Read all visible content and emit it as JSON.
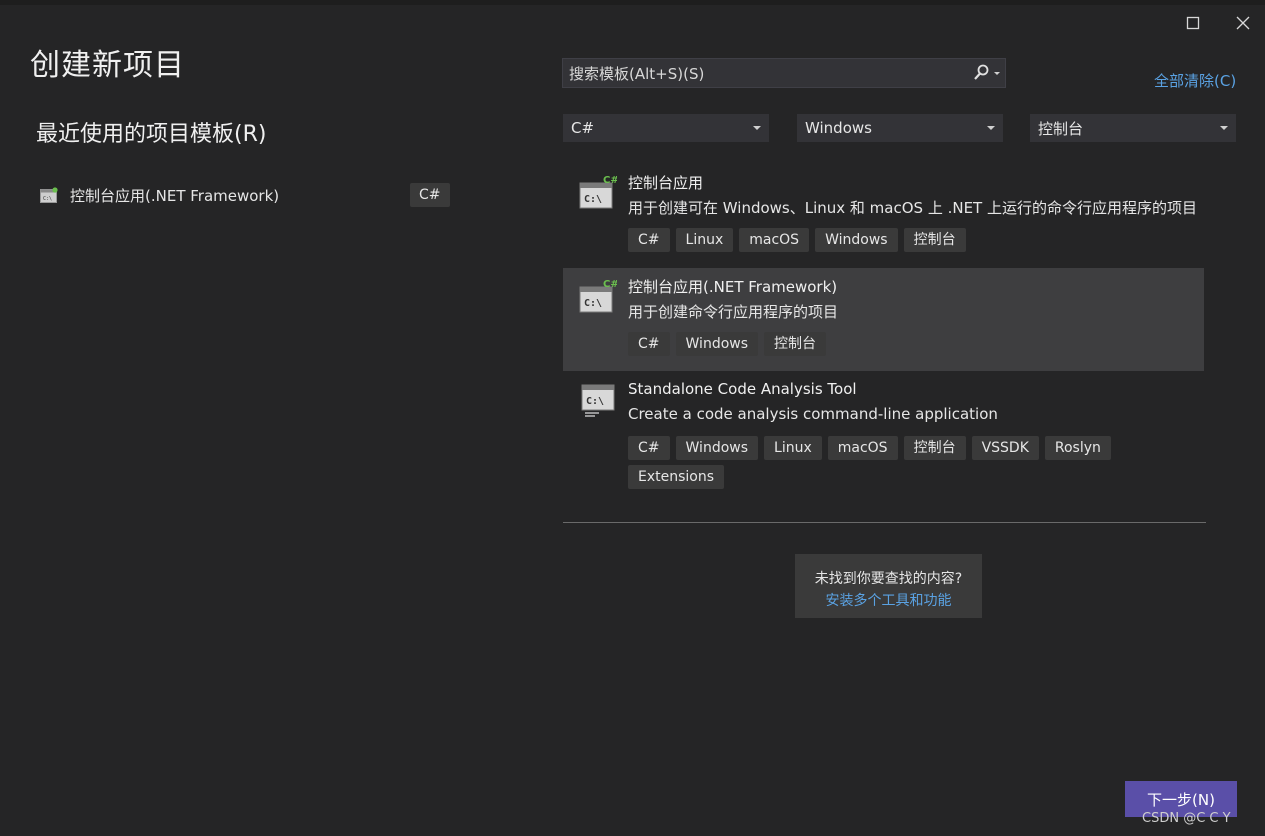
{
  "page": {
    "title": "创建新项目"
  },
  "recent": {
    "heading": "最近使用的项目模板(R)",
    "items": [
      {
        "label": "控制台应用(.NET Framework)",
        "language": "C#",
        "icon": "console-csharp-icon"
      }
    ]
  },
  "search": {
    "placeholder": "搜索模板(Alt+S)(S)",
    "icon": "search-icon"
  },
  "clear_all": "全部清除(C)",
  "filters": {
    "language": "C#",
    "platform": "Windows",
    "project_type": "控制台"
  },
  "templates": [
    {
      "name": "控制台应用",
      "description": "用于创建可在 Windows、Linux 和 macOS 上 .NET 上运行的命令行应用程序的项目",
      "tags": [
        "C#",
        "Linux",
        "macOS",
        "Windows",
        "控制台"
      ],
      "icon": "console-csharp-icon"
    },
    {
      "name": "控制台应用(.NET Framework)",
      "description": "用于创建命令行应用程序的项目",
      "tags": [
        "C#",
        "Windows",
        "控制台"
      ],
      "icon": "console-csharp-icon",
      "selected": true
    },
    {
      "name": "Standalone Code Analysis Tool",
      "description": "Create a code analysis command-line application",
      "tags": [
        "C#",
        "Windows",
        "Linux",
        "macOS",
        "控制台",
        "VSSDK",
        "Roslyn",
        "Extensions"
      ],
      "icon": "console-analysis-icon"
    }
  ],
  "not_found": {
    "question": "未找到你要查找的内容?",
    "link": "安装多个工具和功能"
  },
  "buttons": {
    "next": "下一步(N)"
  },
  "watermark": "CSDN @C    C  Y",
  "colors": {
    "background": "#252526",
    "link": "#5aa2e3",
    "primary_button": "#5a4fa8",
    "selected_row": "#3e3e40",
    "csharp_badge": "#6bbf4e"
  }
}
